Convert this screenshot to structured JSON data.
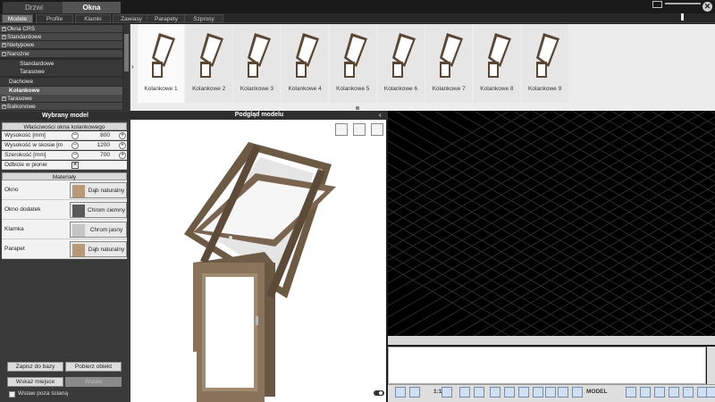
{
  "top_tabs": [
    {
      "label": "Drzwi"
    },
    {
      "label": "Okna"
    }
  ],
  "close_label": "✕",
  "sub_tabs": [
    {
      "label": "Modele"
    },
    {
      "label": "Profile"
    },
    {
      "label": "Klamki"
    },
    {
      "label": "Zawiasy"
    },
    {
      "label": "Parapety"
    },
    {
      "label": "Szprosy"
    }
  ],
  "tree": {
    "items": [
      {
        "label": "Okna CRS",
        "sign": "+"
      },
      {
        "label": "Standardowe",
        "sign": "+"
      },
      {
        "label": "Nietypowe",
        "sign": "+"
      },
      {
        "label": "Narożne",
        "sign": "−"
      },
      {
        "label": "Standardowe"
      },
      {
        "label": "Tarasowe"
      },
      {
        "label": "Dachowe"
      },
      {
        "label": "Kolankowe"
      },
      {
        "label": "Tarasowe",
        "sign": "+"
      },
      {
        "label": "Balkonowe",
        "sign": "+"
      }
    ]
  },
  "thumbnails": [
    {
      "label": "Kolankowe 1"
    },
    {
      "label": "Kolankowe 2"
    },
    {
      "label": "Kolankowe 3"
    },
    {
      "label": "Kolankowe 4"
    },
    {
      "label": "Kolankowe 5"
    },
    {
      "label": "Kolankowe 6"
    },
    {
      "label": "Kolankowe 7"
    },
    {
      "label": "Kolankowe 8"
    },
    {
      "label": "Kolankowe 9"
    }
  ],
  "panel": {
    "title": "Wybrany model",
    "props_title": "Właściwości okna kolankowego",
    "props": [
      {
        "label": "Wysokość [mm]",
        "value": "800"
      },
      {
        "label": "Wysokość w skosie [m",
        "value": "1200"
      },
      {
        "label": "Szerokość [mm]",
        "value": "700"
      }
    ],
    "mirror_label": "Odbicie w pionie",
    "mirror_mark": "✕",
    "materials_title": "Materiały",
    "materials": [
      {
        "label": "Okno",
        "name": "Dąb naturalny",
        "color": "#b99a78"
      },
      {
        "label": "Okno dodatek",
        "name": "Chrom ciemny",
        "color": "#5a5a5a"
      },
      {
        "label": "Klamka",
        "name": "Chrom jasny",
        "color": "#c4c4c4"
      },
      {
        "label": "Parapet",
        "name": "Dąb naturalny",
        "color": "#b99a78"
      }
    ],
    "buttons": {
      "save": "Zapisz do bazy",
      "fetch": "Pobierz obiekt",
      "point": "Wskaż miejsce",
      "insert": "Wstaw"
    },
    "insert_wall": "Wstaw poza ścianą"
  },
  "preview": {
    "title": "Podgląd modelu",
    "collapse": "‹"
  },
  "statusbar": {
    "model": "MODEL",
    "scale": "1:1"
  }
}
